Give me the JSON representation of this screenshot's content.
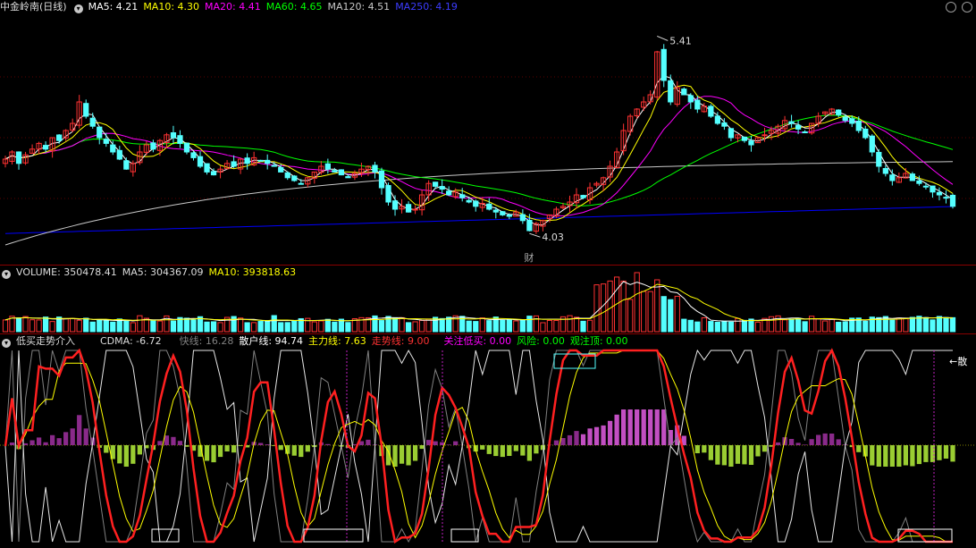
{
  "price_header": {
    "title": "中金岭南(日线)",
    "ma5": "MA5: 4.21",
    "ma10": "MA10: 4.30",
    "ma20": "MA20: 4.41",
    "ma60": "MA60: 4.65",
    "ma120": "MA120: 4.51",
    "ma250": "MA250: 4.19"
  },
  "volume_header": {
    "volume": "VOLUME: 350478.41",
    "ma5": "MA5: 304367.09",
    "ma10": "MA10: 393818.63"
  },
  "indicator_header": {
    "name": "低买走势介入",
    "cdma": "CDMA: -6.72",
    "kuaixian": "快线: 16.28",
    "sanhu": "散户线: 94.74",
    "zhuli": "主力线: 7.63",
    "zoushi": "走势线: 9.00",
    "guanzhu": "关注低买: 0.00",
    "fengxian": "风险: 0.00",
    "guanzhuding": "观注顶: 0.00"
  },
  "annotations": {
    "high": "5.41",
    "low": "4.03",
    "cai": "财",
    "san_label": "←散"
  },
  "colors": {
    "up": "#ff3232",
    "down": "#54ffff",
    "ma5": "#ffffff",
    "ma10": "#ffff00",
    "ma20": "#ff00ff",
    "ma60": "#00ff00",
    "ma120": "#c8c8c8",
    "ma250": "#0000ff"
  },
  "chart_data": {
    "type": "candlestick",
    "series_names": [
      "MA5",
      "MA10",
      "MA20",
      "MA60",
      "MA120",
      "MA250"
    ],
    "high": 5.41,
    "low": 4.03,
    "ylim": [
      3.85,
      5.55
    ],
    "closes": [
      4.55,
      4.6,
      4.52,
      4.58,
      4.62,
      4.66,
      4.62,
      4.7,
      4.68,
      4.75,
      4.8,
      4.95,
      4.85,
      4.78,
      4.7,
      4.66,
      4.6,
      4.55,
      4.48,
      4.52,
      4.6,
      4.65,
      4.62,
      4.68,
      4.72,
      4.7,
      4.66,
      4.6,
      4.56,
      4.5,
      4.46,
      4.44,
      4.48,
      4.52,
      4.5,
      4.55,
      4.52,
      4.56,
      4.54,
      4.52,
      4.5,
      4.46,
      4.42,
      4.4,
      4.38,
      4.42,
      4.46,
      4.5,
      4.48,
      4.46,
      4.44,
      4.42,
      4.45,
      4.48,
      4.5,
      4.46,
      4.35,
      4.25,
      4.2,
      4.22,
      4.18,
      4.2,
      4.3,
      4.38,
      4.36,
      4.34,
      4.3,
      4.32,
      4.28,
      4.25,
      4.22,
      4.24,
      4.2,
      4.18,
      4.16,
      4.15,
      4.18,
      4.12,
      4.05,
      4.1,
      4.12,
      4.16,
      4.2,
      4.22,
      4.25,
      4.3,
      4.28,
      4.35,
      4.38,
      4.42,
      4.5,
      4.6,
      4.75,
      4.85,
      4.9,
      4.95,
      5.0,
      5.3,
      5.1,
      4.95,
      5.05,
      5.0,
      4.95,
      4.9,
      4.92,
      4.85,
      4.8,
      4.78,
      4.7,
      4.72,
      4.68,
      4.65,
      4.7,
      4.72,
      4.75,
      4.78,
      4.82,
      4.8,
      4.76,
      4.74,
      4.8,
      4.85,
      4.88,
      4.9,
      4.86,
      4.82,
      4.8,
      4.75,
      4.7,
      4.6,
      4.5,
      4.45,
      4.4,
      4.42,
      4.45,
      4.4,
      4.38,
      4.36,
      4.32,
      4.3,
      4.28,
      4.22
    ]
  }
}
